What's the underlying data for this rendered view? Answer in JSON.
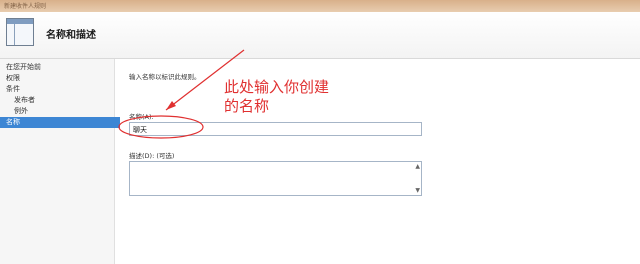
{
  "window": {
    "title": "新建收件人规则"
  },
  "header": {
    "title": "名称和描述"
  },
  "sidebar": {
    "items": [
      {
        "label": "在您开始前"
      },
      {
        "label": "权限"
      },
      {
        "label": "条件"
      },
      {
        "label": "发布者"
      },
      {
        "label": "例外"
      },
      {
        "label": "名称"
      }
    ],
    "active_index": 5
  },
  "content": {
    "prompt": "输入名称以标识此规则。",
    "name_label": "名称(A):",
    "name_value": "聊天",
    "desc_label": "描述(D): (可选)",
    "desc_value": ""
  },
  "annotation": {
    "line1": "此处输入你创建",
    "line2": "的名称",
    "color": "#e03030"
  }
}
